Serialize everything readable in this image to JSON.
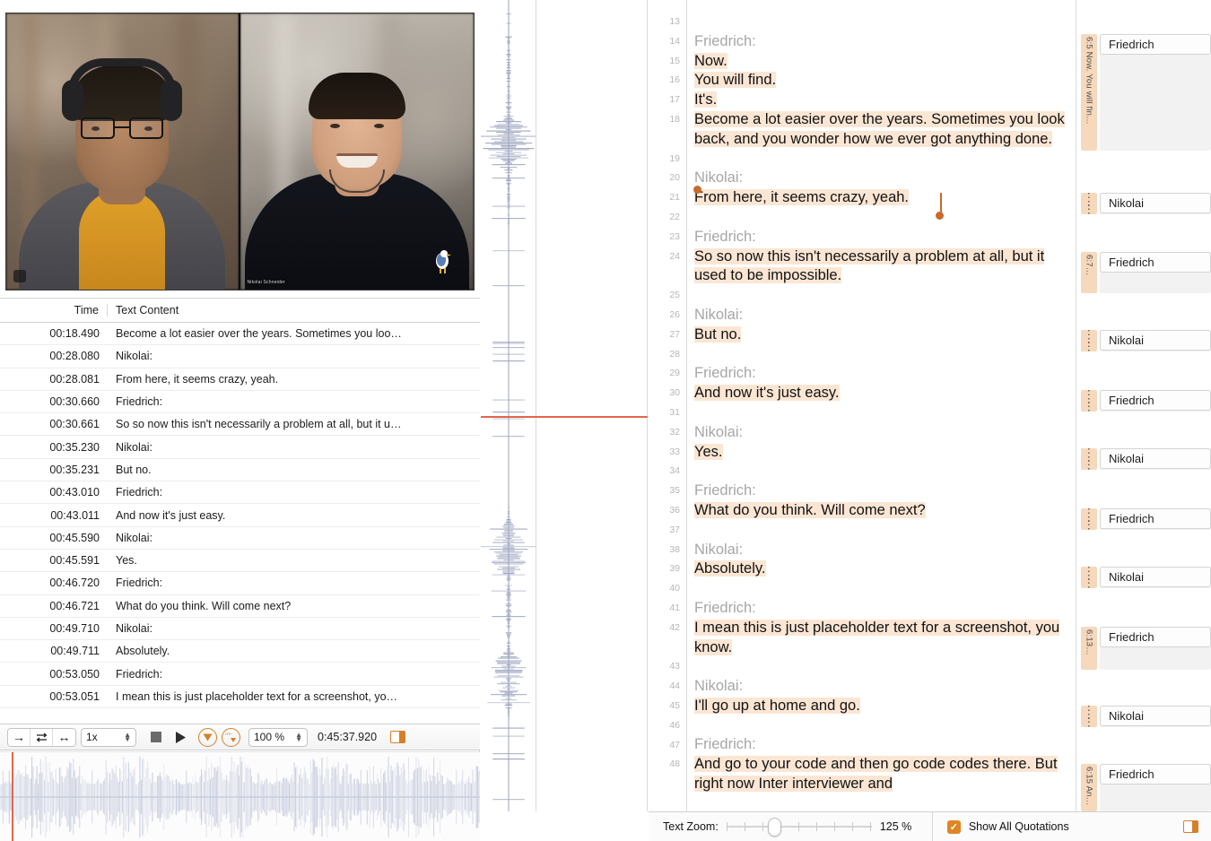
{
  "video": {
    "left_participant_label": "",
    "right_participant_label": "Nikolai Schneider"
  },
  "table": {
    "headers": {
      "time": "Time",
      "text": "Text Content"
    },
    "rows": [
      {
        "time": "00:18.490",
        "text": "Become a lot easier over the years. Sometimes you loo…"
      },
      {
        "time": "00:28.080",
        "text": "Nikolai:"
      },
      {
        "time": "00:28.081",
        "text": "From here, it seems crazy, yeah."
      },
      {
        "time": "00:30.660",
        "text": "Friedrich:"
      },
      {
        "time": "00:30.661",
        "text": "So so now this isn't necessarily a problem at all, but it u…"
      },
      {
        "time": "00:35.230",
        "text": "Nikolai:"
      },
      {
        "time": "00:35.231",
        "text": "But no."
      },
      {
        "time": "00:43.010",
        "text": "Friedrich:"
      },
      {
        "time": "00:43.011",
        "text": "And now it's just easy."
      },
      {
        "time": "00:45.590",
        "text": "Nikolai:"
      },
      {
        "time": "00:45.591",
        "text": "Yes."
      },
      {
        "time": "00:46.720",
        "text": "Friedrich:"
      },
      {
        "time": "00:46.721",
        "text": "What do you think. Will come next?"
      },
      {
        "time": "00:49.710",
        "text": "Nikolai:"
      },
      {
        "time": "00:49.711",
        "text": "Absolutely."
      },
      {
        "time": "00:53.050",
        "text": "Friedrich:"
      },
      {
        "time": "00:53.051",
        "text": "I mean this is just placeholder text for a screenshot, yo…"
      }
    ]
  },
  "media_toolbar": {
    "jump_icon": "arrow-right-icon",
    "loop_icon": "loop-icon",
    "resize_icon": "arrows-horizontal-icon",
    "speed_value": "1x",
    "stop_icon": "stop-icon",
    "play_icon": "play-icon",
    "filter_icon": "filter-triangle-icon",
    "quote_icon": "quotation-icon",
    "zoom_value": "100 %",
    "time_position": "0:45:37.920",
    "panel_toggle_icon": "panel-toggle-icon"
  },
  "transcript": {
    "paragraphs": [
      {
        "lineno_blank": "13",
        "lineno_speaker": "14",
        "speaker": "Friedrich:",
        "lines": [
          {
            "no": "15",
            "text": "Now."
          },
          {
            "no": "16",
            "text": "You will find."
          },
          {
            "no": "17",
            "text": "It's."
          },
          {
            "no": "18",
            "text": "Become a lot easier over the years. Sometimes you look back, and you wonder how we ever got anything done."
          }
        ]
      },
      {
        "lineno_blank": "19",
        "lineno_speaker": "20",
        "speaker": "Nikolai:",
        "lines": [
          {
            "no": "21",
            "text": "From here, it seems crazy, yeah."
          }
        ]
      },
      {
        "lineno_blank": "22",
        "lineno_speaker": "23",
        "speaker": "Friedrich:",
        "lines": [
          {
            "no": "24",
            "text": "So so now this isn't necessarily a problem at all, but it used to be impossible."
          }
        ]
      },
      {
        "lineno_blank": "25",
        "lineno_speaker": "26",
        "speaker": "Nikolai:",
        "lines": [
          {
            "no": "27",
            "text": "But no."
          }
        ]
      },
      {
        "lineno_blank": "28",
        "lineno_speaker": "29",
        "speaker": "Friedrich:",
        "lines": [
          {
            "no": "30",
            "text": "And now it's just easy."
          }
        ]
      },
      {
        "lineno_blank": "31",
        "lineno_speaker": "32",
        "speaker": "Nikolai:",
        "lines": [
          {
            "no": "33",
            "text": "Yes."
          }
        ]
      },
      {
        "lineno_blank": "34",
        "lineno_speaker": "35",
        "speaker": "Friedrich:",
        "lines": [
          {
            "no": "36",
            "text": "What do you think. Will come next?"
          }
        ]
      },
      {
        "lineno_blank": "37",
        "lineno_speaker": "38",
        "speaker": "Nikolai:",
        "lines": [
          {
            "no": "39",
            "text": "Absolutely."
          }
        ]
      },
      {
        "lineno_blank": "40",
        "lineno_speaker": "41",
        "speaker": "Friedrich:",
        "lines": [
          {
            "no": "42",
            "text": "I mean this is just placeholder text for a screenshot, you know."
          }
        ]
      },
      {
        "lineno_blank": "43",
        "lineno_speaker": "44",
        "speaker": "Nikolai:",
        "lines": [
          {
            "no": "45",
            "text": "I'll go up at home and go."
          }
        ]
      },
      {
        "lineno_blank": "46",
        "lineno_speaker": "47",
        "speaker": "Friedrich:",
        "lines": [
          {
            "no": "48",
            "text": "And go to your code and then go code codes there. But right now Inter interviewer and"
          }
        ]
      }
    ]
  },
  "margin": {
    "quotations": [
      {
        "tag": "6:5 Now. You will fin…",
        "speaker": "Friedrich"
      },
      {
        "tag": "",
        "speaker": "Nikolai"
      },
      {
        "tag": "6:7…",
        "speaker": "Friedrich"
      },
      {
        "tag": "",
        "speaker": "Nikolai"
      },
      {
        "tag": "",
        "speaker": "Friedrich"
      },
      {
        "tag": "",
        "speaker": "Nikolai"
      },
      {
        "tag": "",
        "speaker": "Friedrich"
      },
      {
        "tag": "",
        "speaker": "Nikolai"
      },
      {
        "tag": "6:13…",
        "speaker": "Friedrich"
      },
      {
        "tag": "",
        "speaker": "Nikolai"
      },
      {
        "tag": "6:15 An…",
        "speaker": "Friedrich"
      }
    ]
  },
  "statusbar": {
    "text_zoom_label": "Text Zoom:",
    "text_zoom_value": "125 %",
    "show_all_quotations_label": "Show All Quotations",
    "checkbox_checked": "✓",
    "panel_toggle_icon": "panel-toggle-icon"
  },
  "colors": {
    "highlight": "#fbe6d4",
    "accent_orange": "#d4802a",
    "playhead_red": "#e2674a",
    "waveform_blue": "#9aa2bd",
    "tag_bg": "#f6d9bd"
  }
}
